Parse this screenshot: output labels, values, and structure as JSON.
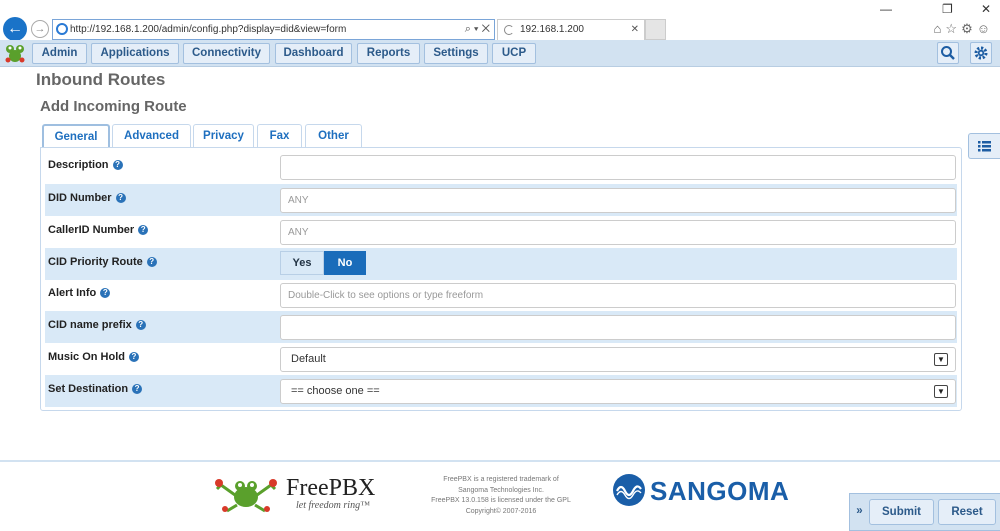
{
  "browser": {
    "url": "http://192.168.1.200/admin/config.php?display=did&view=form",
    "tab_title": "192.168.1.200",
    "window_controls": [
      "—",
      "❐",
      "✕"
    ],
    "toolbar_icons": [
      "home-icon",
      "star-icon",
      "gear-icon",
      "smiley-icon"
    ]
  },
  "nav": {
    "items": [
      "Admin",
      "Applications",
      "Connectivity",
      "Dashboard",
      "Reports",
      "Settings",
      "UCP"
    ],
    "icons": [
      "search-icon",
      "gear-icon"
    ]
  },
  "page": {
    "title": "Inbound Routes",
    "subtitle": "Add Incoming Route"
  },
  "tabs": [
    "General",
    "Advanced",
    "Privacy",
    "Fax",
    "Other"
  ],
  "form": {
    "description": {
      "label": "Description",
      "value": "",
      "placeholder": ""
    },
    "did_number": {
      "label": "DID Number",
      "placeholder": "ANY"
    },
    "callerid_number": {
      "label": "CallerID Number",
      "placeholder": "ANY"
    },
    "cid_priority": {
      "label": "CID Priority Route",
      "options": [
        "Yes",
        "No"
      ],
      "selected": "No"
    },
    "alert_info": {
      "label": "Alert Info",
      "placeholder": "Double-Click to see options or type freeform"
    },
    "cid_name_prefix": {
      "label": "CID name prefix",
      "value": ""
    },
    "music_on_hold": {
      "label": "Music On Hold",
      "value": "Default"
    },
    "set_destination": {
      "label": "Set Destination",
      "value": "== choose one =="
    }
  },
  "footer": {
    "brand": "FreePBX",
    "tagline": "let freedom ring™",
    "legal": [
      "FreePBX is a registered trademark of",
      "Sangoma Technologies Inc.",
      "FreePBX 13.0.158 is licensed under the GPL",
      "Copyright© 2007-2016"
    ],
    "partner": "SANGOMA"
  },
  "actions": {
    "expand": "»",
    "submit": "Submit",
    "reset": "Reset"
  },
  "colors": {
    "nav_bg": "#d2e2f1",
    "accent": "#1a6cba",
    "row_alt": "#d9e9f7",
    "link": "#1e6fbf"
  }
}
